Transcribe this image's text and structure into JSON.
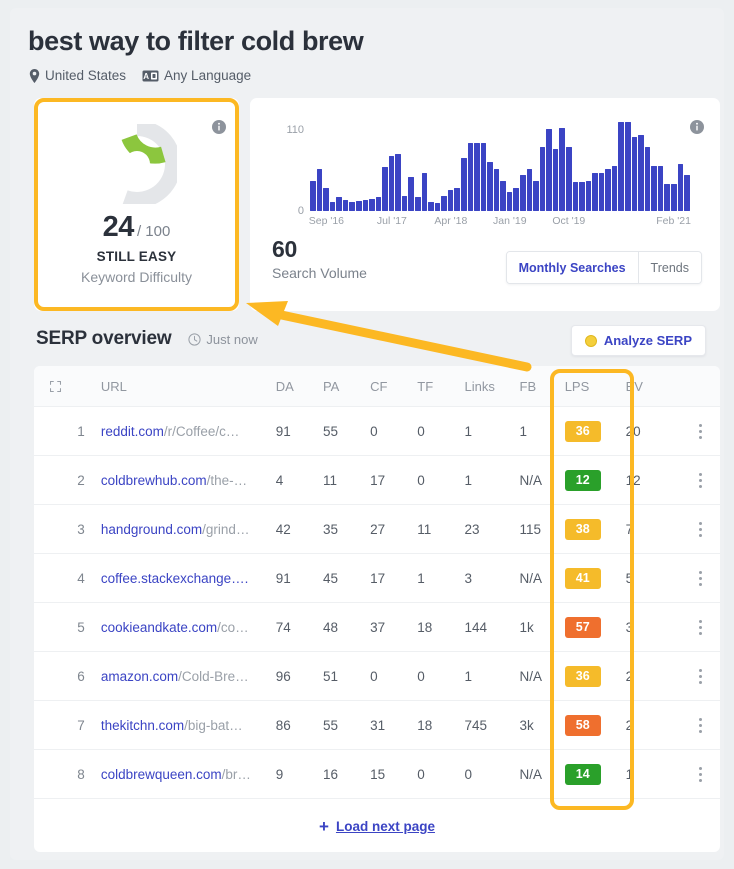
{
  "header": {
    "keyword": "best way to filter cold brew",
    "location": "United States",
    "language": "Any Language",
    "location_icon": "map-pin-icon",
    "language_icon": "translate-icon"
  },
  "keyword_difficulty": {
    "score": "24",
    "max": "/ 100",
    "verdict": "STILL EASY",
    "caption": "Keyword Difficulty",
    "info_icon": "info-icon",
    "gauge_percent": 24,
    "gauge_color": "#8cc63e",
    "gauge_track_color": "#e4e6e9"
  },
  "search_volume": {
    "value": "60",
    "caption": "Search Volume",
    "info_icon": "info-icon",
    "tabs": [
      {
        "label": "Monthly Searches",
        "active": true
      },
      {
        "label": "Trends",
        "active": false
      }
    ]
  },
  "chart_data": {
    "type": "bar",
    "title": "",
    "xlabel": "",
    "ylabel": "",
    "ylim": [
      0,
      120
    ],
    "ytick_labels": [
      "110",
      "0"
    ],
    "grid": false,
    "legend": null,
    "bar_color": "#3b44c4",
    "xtick_labels": [
      "Sep '16",
      "Jul '17",
      "Apr '18",
      "Jan '19",
      "Oct '19",
      "Feb '21"
    ],
    "xtick_positions": [
      2,
      12,
      21,
      30,
      39,
      55
    ],
    "values": [
      40,
      55,
      30,
      12,
      18,
      14,
      12,
      13,
      15,
      16,
      18,
      58,
      72,
      75,
      20,
      45,
      18,
      50,
      12,
      10,
      20,
      28,
      30,
      70,
      90,
      90,
      90,
      65,
      55,
      40,
      25,
      30,
      48,
      55,
      40,
      85,
      108,
      82,
      110,
      85,
      38,
      38,
      40,
      50,
      50,
      55,
      60,
      118,
      118,
      98,
      100,
      85,
      60,
      60,
      35,
      35,
      62,
      48
    ]
  },
  "serp": {
    "title": "SERP overview",
    "updated": "Just now",
    "clock_icon": "clock-icon",
    "analyze_button": "Analyze SERP",
    "coin_icon": "coin-icon",
    "columns": {
      "expand_icon": "expand-icon",
      "url": "URL",
      "da": "DA",
      "pa": "PA",
      "cf": "CF",
      "tf": "TF",
      "links": "Links",
      "fb": "FB",
      "lps": "LPS",
      "ev": "EV"
    },
    "rows": [
      {
        "rank": "1",
        "domain": "reddit.com",
        "path": "/r/Coffee/c…",
        "da": "91",
        "pa": "55",
        "cf": "0",
        "tf": "0",
        "links": "1",
        "fb": "1",
        "lps": "36",
        "lps_color": "#f5bb2a",
        "ev": "20"
      },
      {
        "rank": "2",
        "domain": "coldbrewhub.com",
        "path": "/the-…",
        "da": "4",
        "pa": "11",
        "cf": "17",
        "tf": "0",
        "links": "1",
        "fb": "N/A",
        "lps": "12",
        "lps_color": "#2aa02a",
        "ev": "12"
      },
      {
        "rank": "3",
        "domain": "handground.com",
        "path": "/grind…",
        "da": "42",
        "pa": "35",
        "cf": "27",
        "tf": "11",
        "links": "23",
        "fb": "115",
        "lps": "38",
        "lps_color": "#f5bb2a",
        "ev": "7"
      },
      {
        "rank": "4",
        "domain": "coffee.stackexchange….",
        "path": "",
        "da": "91",
        "pa": "45",
        "cf": "17",
        "tf": "1",
        "links": "3",
        "fb": "N/A",
        "lps": "41",
        "lps_color": "#f5bb2a",
        "ev": "5"
      },
      {
        "rank": "5",
        "domain": "cookieandkate.com",
        "path": "/co…",
        "da": "74",
        "pa": "48",
        "cf": "37",
        "tf": "18",
        "links": "144",
        "fb": "1k",
        "lps": "57",
        "lps_color": "#ef6f2e",
        "ev": "3"
      },
      {
        "rank": "6",
        "domain": "amazon.com",
        "path": "/Cold-Bre…",
        "da": "96",
        "pa": "51",
        "cf": "0",
        "tf": "0",
        "links": "1",
        "fb": "N/A",
        "lps": "36",
        "lps_color": "#f5bb2a",
        "ev": "2"
      },
      {
        "rank": "7",
        "domain": "thekitchn.com",
        "path": "/big-bat…",
        "da": "86",
        "pa": "55",
        "cf": "31",
        "tf": "18",
        "links": "745",
        "fb": "3k",
        "lps": "58",
        "lps_color": "#ef6f2e",
        "ev": "2"
      },
      {
        "rank": "8",
        "domain": "coldbrewqueen.com",
        "path": "/br…",
        "da": "9",
        "pa": "16",
        "cf": "15",
        "tf": "0",
        "links": "0",
        "fb": "N/A",
        "lps": "14",
        "lps_color": "#2aa02a",
        "ev": "1"
      }
    ],
    "load_more": "Load next page",
    "load_more_plus": "+",
    "row_menu_icon": "kebab-menu-icon"
  },
  "annotations": {
    "highlight_color": "#fcb823",
    "kd_card_highlight": true,
    "lps_column_highlight": true,
    "arrow_from_lps_to_kd": true
  }
}
